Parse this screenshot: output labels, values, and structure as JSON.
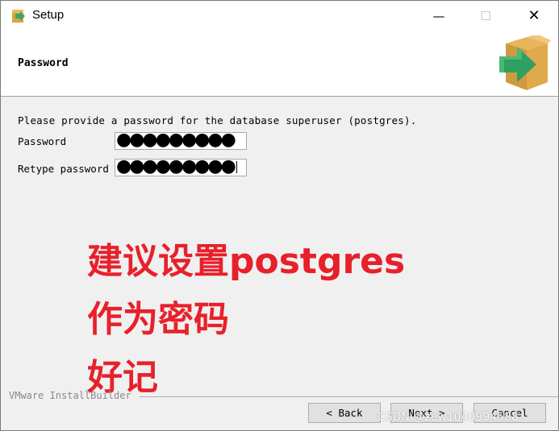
{
  "window": {
    "title": "Setup",
    "minimize_glyph": "—",
    "maximize_glyph": "☐",
    "close_glyph": "✕"
  },
  "header": {
    "title": "Password",
    "logo_icon": "installer-box-arrow-icon"
  },
  "form": {
    "instruction": "Please provide a password for the database superuser (postgres).",
    "password_label": "Password",
    "password_value": "●●●●●●●●●",
    "retype_label": "Retype password",
    "retype_value": "●●●●●●●●●"
  },
  "annotation": {
    "line1": "建议设置postgres",
    "line2": "作为密码",
    "line3": "好记",
    "color": "#e8202a"
  },
  "footer": {
    "brand": "VMware InstallBuilder",
    "back_label": "< Back",
    "next_label": "Next >",
    "cancel_label": "Cancel"
  },
  "watermark": "CSDN @zew1040994588"
}
